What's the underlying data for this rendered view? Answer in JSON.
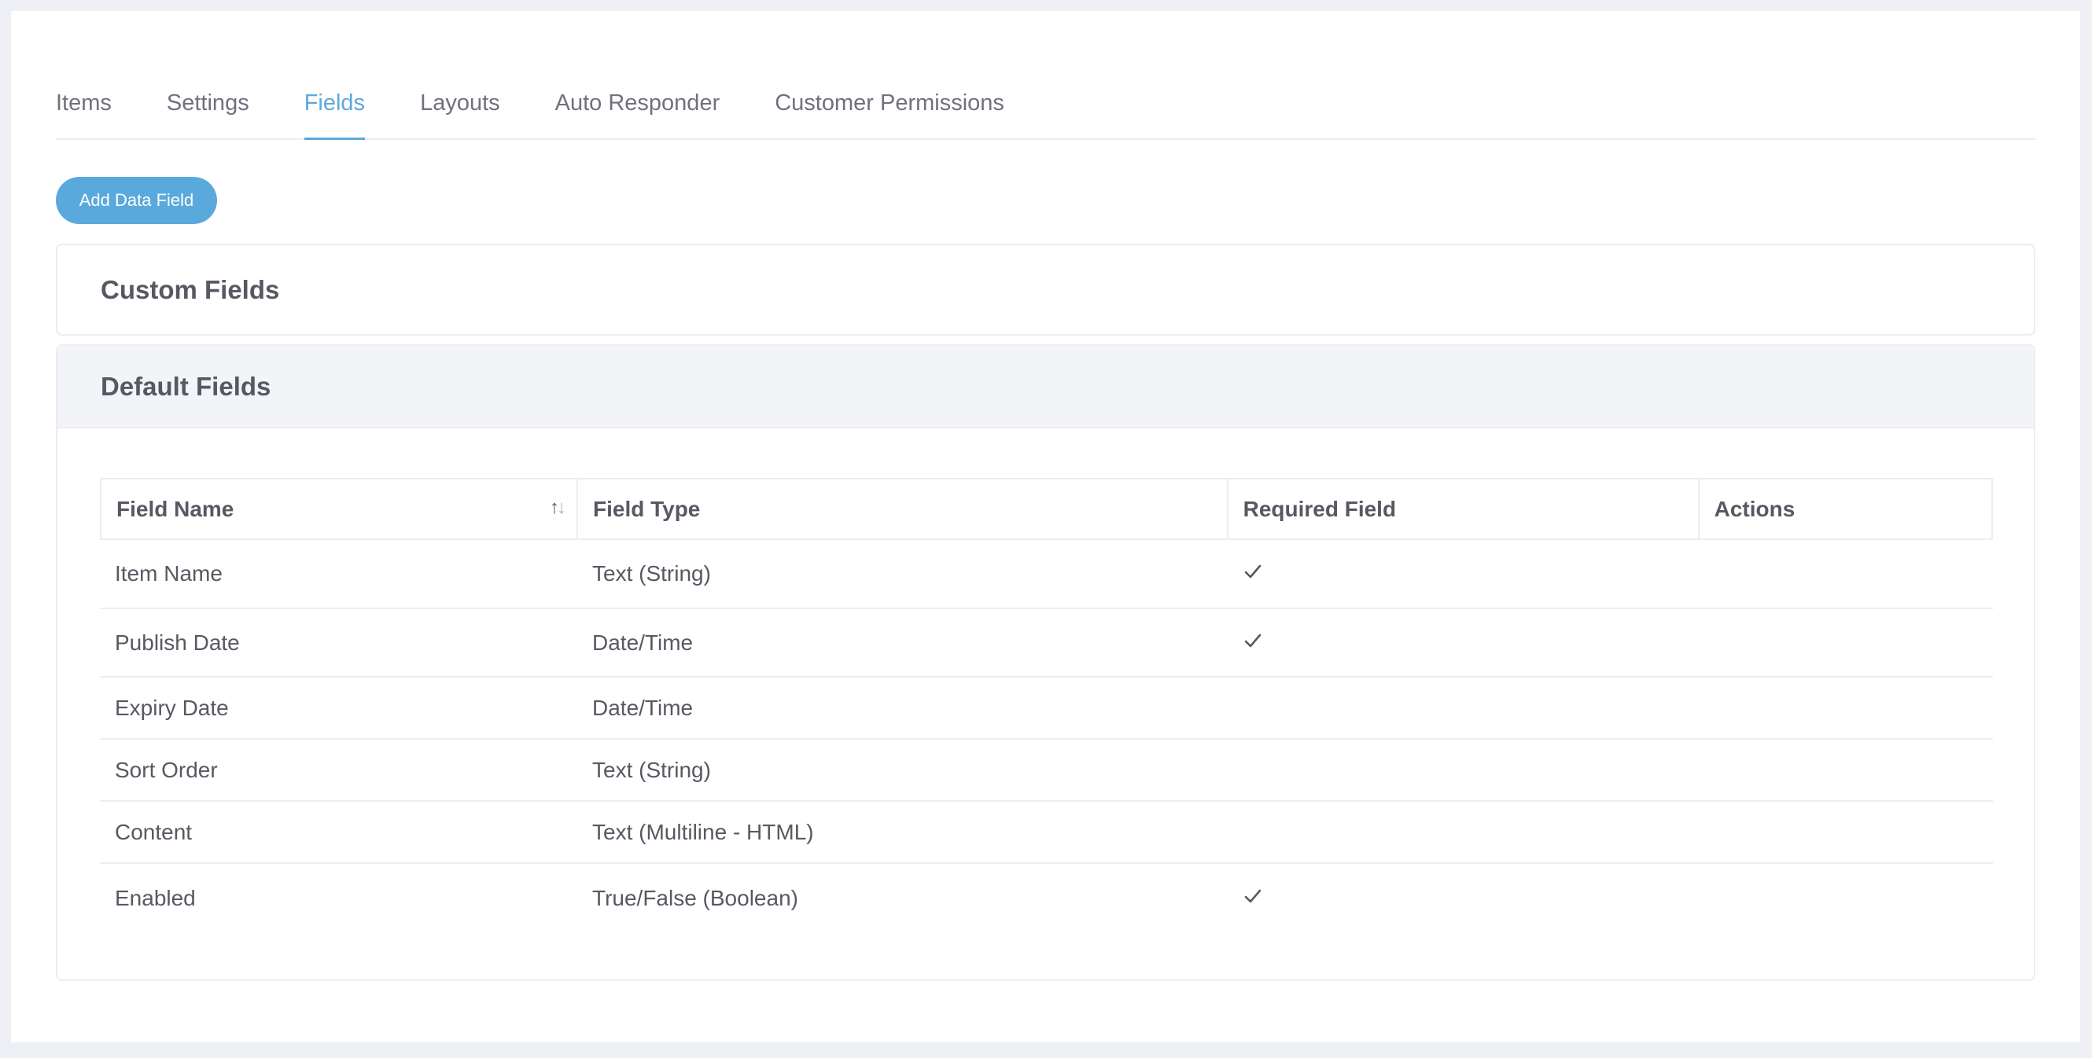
{
  "tabs": [
    {
      "label": "Items",
      "active": false
    },
    {
      "label": "Settings",
      "active": false
    },
    {
      "label": "Fields",
      "active": true
    },
    {
      "label": "Layouts",
      "active": false
    },
    {
      "label": "Auto Responder",
      "active": false
    },
    {
      "label": "Customer Permissions",
      "active": false
    }
  ],
  "add_button_label": "Add Data Field",
  "custom_fields": {
    "title": "Custom Fields"
  },
  "default_fields": {
    "title": "Default Fields",
    "columns": [
      "Field Name",
      "Field Type",
      "Required Field",
      "Actions"
    ],
    "sort_icon": "sort-arrows-icon",
    "rows": [
      {
        "name": "Item Name",
        "type": "Text (String)",
        "required": true
      },
      {
        "name": "Publish Date",
        "type": "Date/Time",
        "required": true
      },
      {
        "name": "Expiry Date",
        "type": "Date/Time",
        "required": false
      },
      {
        "name": "Sort Order",
        "type": "Text (String)",
        "required": false
      },
      {
        "name": "Content",
        "type": "Text (Multiline - HTML)",
        "required": false
      },
      {
        "name": "Enabled",
        "type": "True/False (Boolean)",
        "required": true
      }
    ]
  },
  "colors": {
    "accent": "#5aa9dd",
    "text": "#575962",
    "border": "#ebedf2",
    "panel_header_bg": "#f3f4f8",
    "page_bg": "#eef0f5"
  }
}
